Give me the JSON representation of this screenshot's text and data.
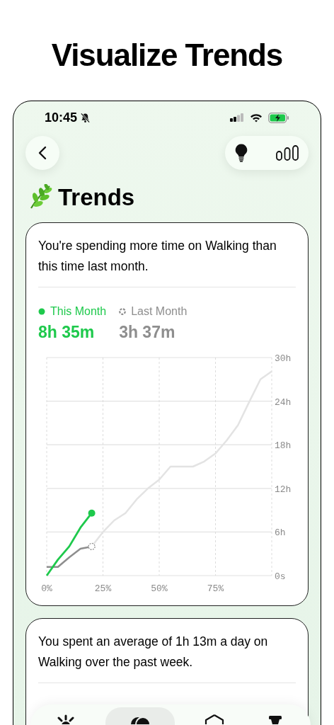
{
  "headline": "Visualize Trends",
  "status_bar": {
    "time": "10:45"
  },
  "title": "Trends",
  "cards": [
    {
      "message": "You're spending more time on Walking than this time last month.",
      "totals": [
        "8h 35m",
        "3h 37m"
      ],
      "chart_data": {
        "type": "line",
        "grid": true,
        "x": [
          0,
          5,
          10,
          15,
          20,
          25,
          30,
          35,
          40,
          45,
          50,
          55,
          60,
          65,
          70,
          75,
          80,
          85,
          90,
          95,
          100
        ],
        "xlim": [
          0,
          100
        ],
        "ylim": [
          0,
          30
        ],
        "xticks": [
          {
            "value": 0,
            "label": "0%"
          },
          {
            "value": 25,
            "label": "25%"
          },
          {
            "value": 50,
            "label": "50%"
          },
          {
            "value": 75,
            "label": "75%"
          }
        ],
        "yticks": [
          {
            "value": 0,
            "label": "0s"
          },
          {
            "value": 6,
            "label": "6h"
          },
          {
            "value": 12,
            "label": "12h"
          },
          {
            "value": 18,
            "label": "18h"
          },
          {
            "value": 24,
            "label": "24h"
          },
          {
            "value": 30,
            "label": "30h"
          }
        ],
        "series": [
          {
            "name": "This Month",
            "color": "#1ec94c",
            "values": [
              0,
              2.2,
              4,
              6.6,
              8.6,
              null,
              null,
              null,
              null,
              null,
              null,
              null,
              null,
              null,
              null,
              null,
              null,
              null,
              null,
              null,
              null
            ]
          },
          {
            "name": "Last Month",
            "color": "#8e8e8e",
            "values": [
              1.2,
              1.2,
              2.5,
              3.7,
              4,
              null,
              null,
              null,
              null,
              null,
              null,
              null,
              null,
              null,
              null,
              null,
              null,
              null,
              null,
              null,
              null
            ]
          },
          {
            "color": "#e3e3e3",
            "values": [
              null,
              null,
              null,
              null,
              4,
              6,
              7.6,
              8.6,
              10.5,
              12,
              13.2,
              15,
              15,
              15,
              15.7,
              16.8,
              18.6,
              20.7,
              23.9,
              27,
              28.1
            ]
          }
        ]
      }
    },
    {
      "message": "You spent an average of 1h 13m a day on Walking over the past week."
    }
  ],
  "tab_bar": {
    "tabs": [
      {
        "selected": false
      },
      {
        "selected": true
      },
      {
        "selected": false
      },
      {
        "selected": false
      }
    ]
  }
}
